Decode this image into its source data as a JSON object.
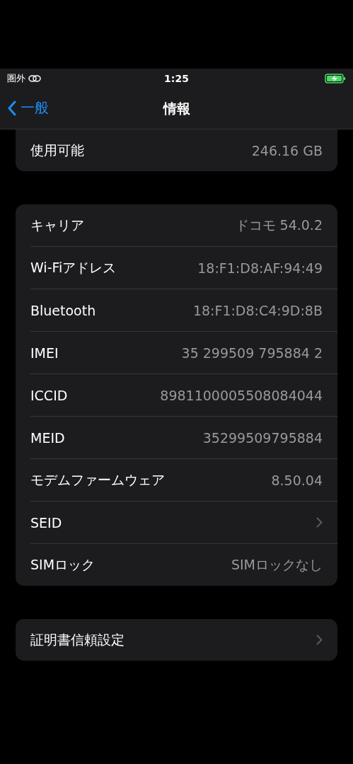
{
  "status_bar": {
    "carrier": "圏外",
    "time": "1:25",
    "charging": true
  },
  "nav": {
    "back": "一般",
    "title": "情報"
  },
  "sections": [
    {
      "cut_top": true,
      "rows": [
        {
          "kind": "value",
          "label": "使用可能",
          "value": "246.16 GB"
        }
      ]
    },
    {
      "cut_top": false,
      "rows": [
        {
          "kind": "value",
          "label": "キャリア",
          "value": "ドコモ 54.0.2"
        },
        {
          "kind": "value",
          "label": "Wi-Fiアドレス",
          "value": "18:F1:D8:AF:94:49"
        },
        {
          "kind": "value",
          "label": "Bluetooth",
          "value": "18:F1:D8:C4:9D:8B"
        },
        {
          "kind": "value",
          "label": "IMEI",
          "value": "35 299509 795884 2"
        },
        {
          "kind": "value",
          "label": "ICCID",
          "value": "8981100005508084044"
        },
        {
          "kind": "value",
          "label": "MEID",
          "value": "35299509795884"
        },
        {
          "kind": "value",
          "label": "モデムファームウェア",
          "value": "8.50.04"
        },
        {
          "kind": "link",
          "label": "SEID"
        },
        {
          "kind": "value",
          "label": "SIMロック",
          "value": "SIMロックなし"
        }
      ]
    },
    {
      "cut_top": false,
      "rows": [
        {
          "kind": "link",
          "label": "証明書信頼設定"
        }
      ]
    }
  ]
}
